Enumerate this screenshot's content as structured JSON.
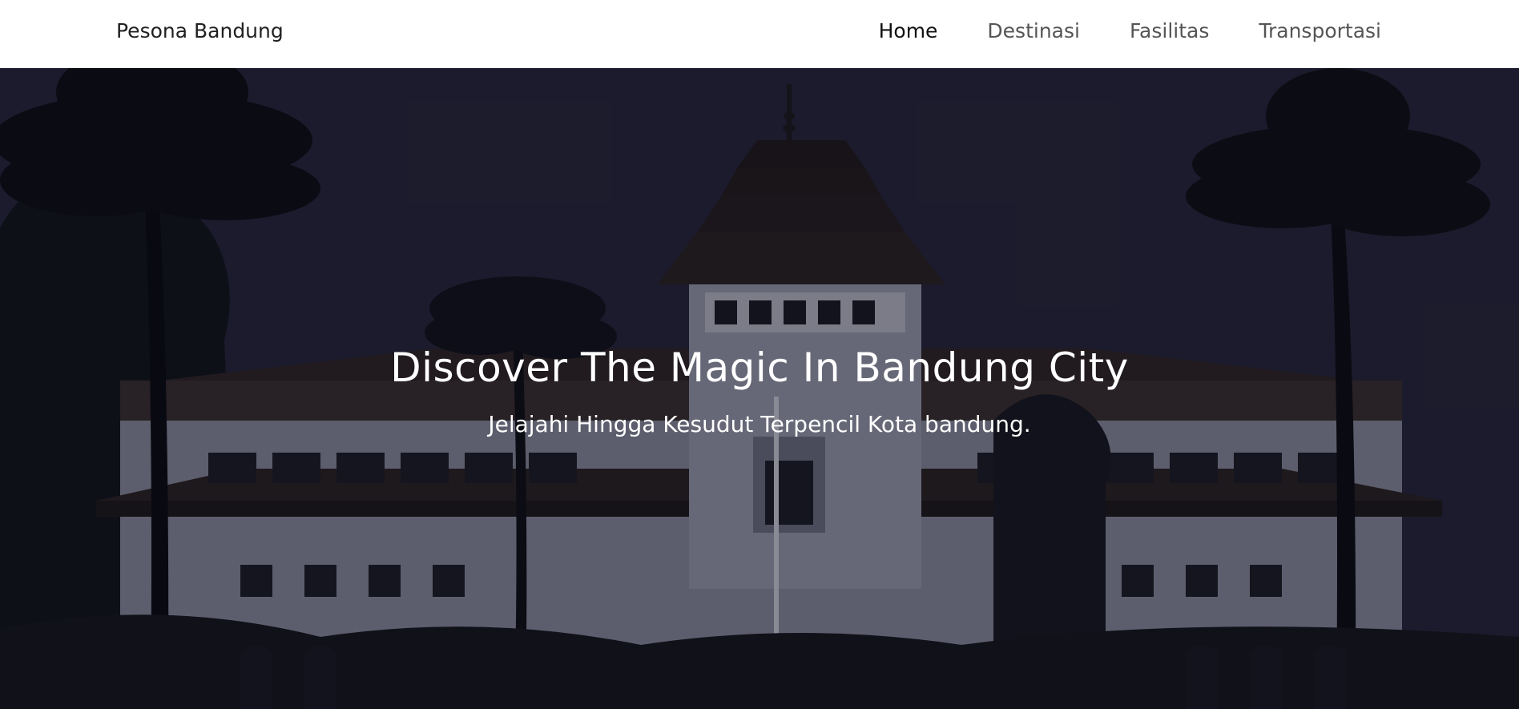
{
  "navbar": {
    "brand": "Pesona Bandung",
    "links": [
      {
        "label": "Home",
        "active": true
      },
      {
        "label": "Destinasi",
        "active": false
      },
      {
        "label": "Fasilitas",
        "active": false
      },
      {
        "label": "Transportasi",
        "active": false
      }
    ]
  },
  "hero": {
    "title": "Discover The Magic In Bandung City",
    "subtitle": "Jelajahi Hingga Kesudut Terpencil Kota bandung.",
    "background_image": "gedung-sate-silhouette"
  },
  "colors": {
    "nav_bg": "#ffffff",
    "nav_active": "#111111",
    "nav_inactive": "#555555",
    "hero_sky": "#252638",
    "hero_text": "#ffffff"
  }
}
